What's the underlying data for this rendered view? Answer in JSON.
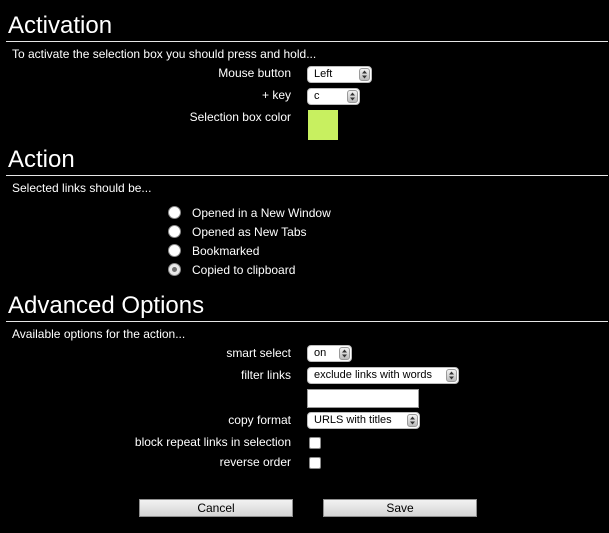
{
  "activation": {
    "title": "Activation",
    "description": "To activate the selection box you should press and hold...",
    "mouse_button_label": "Mouse button",
    "mouse_button_value": "Left",
    "key_label": "+ key",
    "key_value": "c",
    "color_label": "Selection box color",
    "color_value": "#c8f060"
  },
  "action": {
    "title": "Action",
    "description": "Selected links should be...",
    "options": [
      {
        "label": "Opened in a New Window",
        "checked": false
      },
      {
        "label": "Opened as New Tabs",
        "checked": false
      },
      {
        "label": "Bookmarked",
        "checked": false
      },
      {
        "label": "Copied to clipboard",
        "checked": true
      }
    ]
  },
  "advanced": {
    "title": "Advanced Options",
    "description": "Available options for the action...",
    "smart_select_label": "smart select",
    "smart_select_value": "on",
    "filter_links_label": "filter links",
    "filter_links_value": "exclude links with words",
    "filter_words_value": "",
    "copy_format_label": "copy format",
    "copy_format_value": "URLS with titles",
    "block_repeat_label": "block repeat links in selection",
    "block_repeat_checked": false,
    "reverse_order_label": "reverse order",
    "reverse_order_checked": false
  },
  "buttons": {
    "cancel_label": "Cancel",
    "save_label": "Save"
  }
}
